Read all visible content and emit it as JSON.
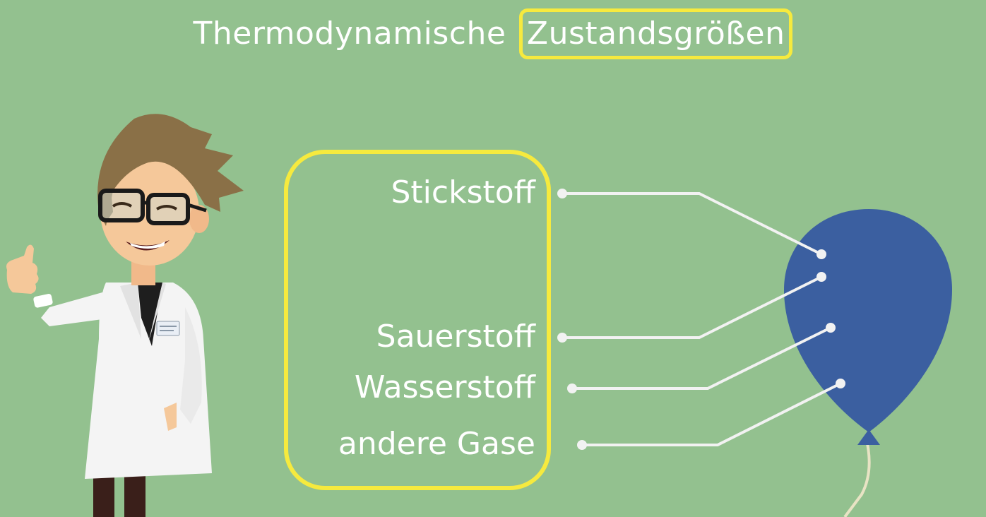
{
  "title": {
    "prefix": "Thermodynamische",
    "highlight": "Zustandsgrößen"
  },
  "gases": [
    {
      "label": "Stickstoff"
    },
    {
      "label": "Sauerstoff"
    },
    {
      "label": "Wasserstoff"
    },
    {
      "label": "andere Gase"
    }
  ],
  "colors": {
    "background": "#93c18f",
    "highlight_border": "#f6ea3e",
    "balloon": "#3b5fa0",
    "connector": "#f2f2f2",
    "text": "#ffffff"
  },
  "icons": [
    "scientist-character",
    "balloon-icon"
  ]
}
